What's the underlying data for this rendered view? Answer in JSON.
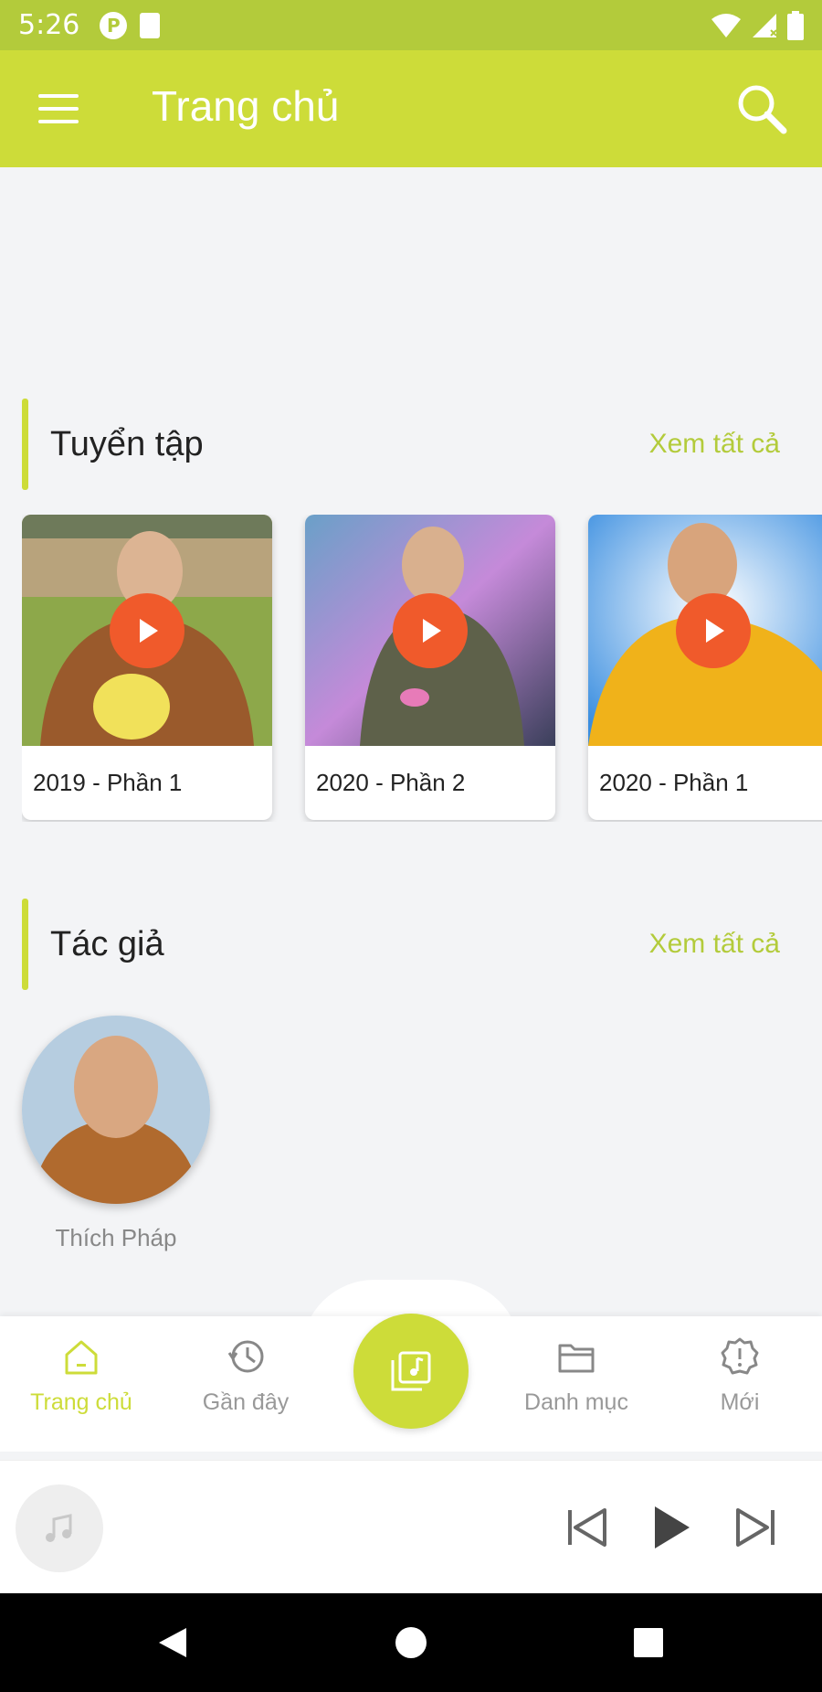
{
  "status_bar": {
    "time": "5:26"
  },
  "app_bar": {
    "title": "Trang chủ"
  },
  "collections": {
    "title": "Tuyển tập",
    "see_all": "Xem tất cả",
    "items": [
      {
        "label": "2019 - Phần 1"
      },
      {
        "label": "2020 - Phần 2"
      },
      {
        "label": "2020 - Phần 1"
      }
    ]
  },
  "authors": {
    "title": "Tác giả",
    "see_all": "Xem tất cả",
    "items": [
      {
        "name": "Thích Pháp"
      }
    ]
  },
  "bottom_nav": {
    "items": [
      {
        "label": "Trang chủ",
        "icon": "home-icon",
        "active": true
      },
      {
        "label": "Gần đây",
        "icon": "history-icon",
        "active": false
      },
      {
        "label": "Danh mục",
        "icon": "folder-icon",
        "active": false
      },
      {
        "label": "Mới",
        "icon": "alert-icon",
        "active": false
      }
    ],
    "center_icon": "music-library-icon"
  },
  "colors": {
    "accent": "#cddc39",
    "status_bar": "#b3cb3b",
    "play": "#f05a2b"
  }
}
